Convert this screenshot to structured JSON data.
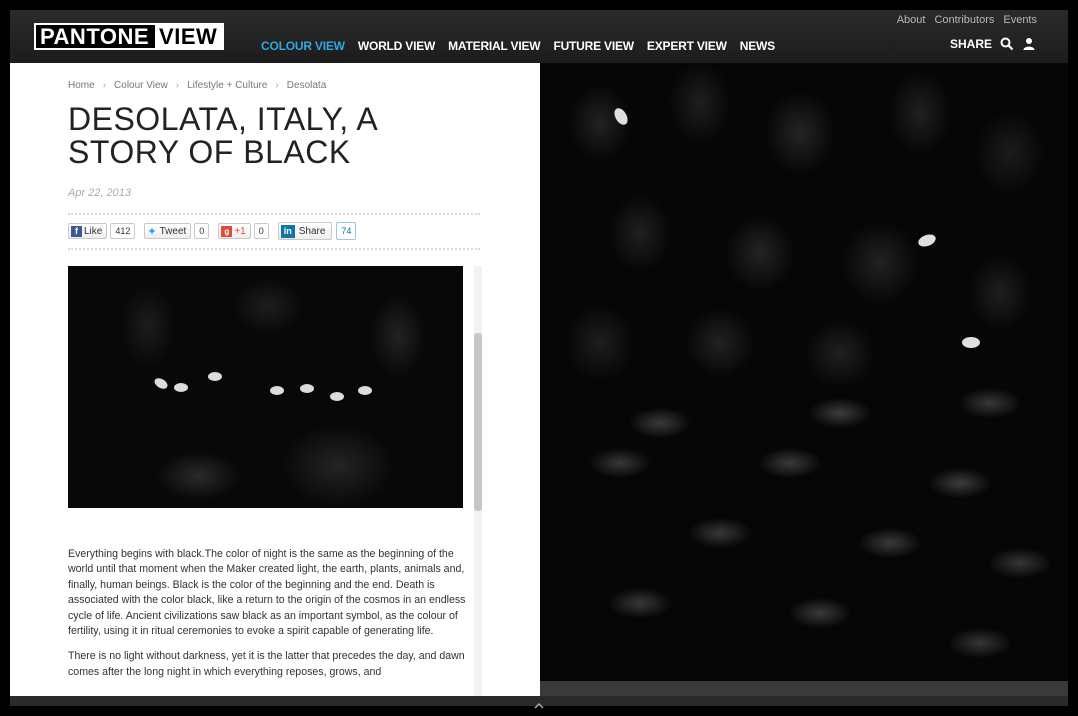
{
  "header": {
    "logo": {
      "part1": "PANTONE",
      "part2": "VIEW"
    },
    "nav": [
      "COLOUR VIEW",
      "WORLD VIEW",
      "MATERIAL VIEW",
      "FUTURE VIEW",
      "EXPERT VIEW",
      "NEWS"
    ],
    "active_nav": "COLOUR VIEW",
    "util_links": [
      "About",
      "Contributors",
      "Events"
    ],
    "share_label": "SHARE",
    "icons": [
      "search-icon",
      "user-icon"
    ],
    "accent_color": "#31a8e0"
  },
  "article": {
    "breadcrumb": [
      "Home",
      "Colour View",
      "Lifestyle + Culture",
      "Desolata"
    ],
    "title": "DESOLATA, ITALY, A STORY OF BLACK",
    "date": "Apr 22, 2013",
    "social": {
      "facebook": {
        "label": "Like",
        "count": "412"
      },
      "twitter": {
        "label": "Tweet",
        "count": "0"
      },
      "google": {
        "label": "+1",
        "count": "0"
      },
      "linkedin": {
        "label": "Share",
        "count": "74"
      }
    },
    "paragraphs": [
      "Everything begins with black.The color of night is the same as the beginning of the world until that moment when the Maker created light, the earth, plants, animals and, finally, human beings. Black is the color of the beginning and the end. Death is associated with the color black, like a return to the origin of the cosmos in an endless cycle of life. Ancient civilizations saw black as an important symbol, as the colour of fertility, using it in ritual ceremonies to evoke a spirit capable of generating life.",
      "There is no light without darkness, yet it is the latter that precedes the day, and dawn comes after the long night in which everything reposes, grows, and"
    ]
  }
}
